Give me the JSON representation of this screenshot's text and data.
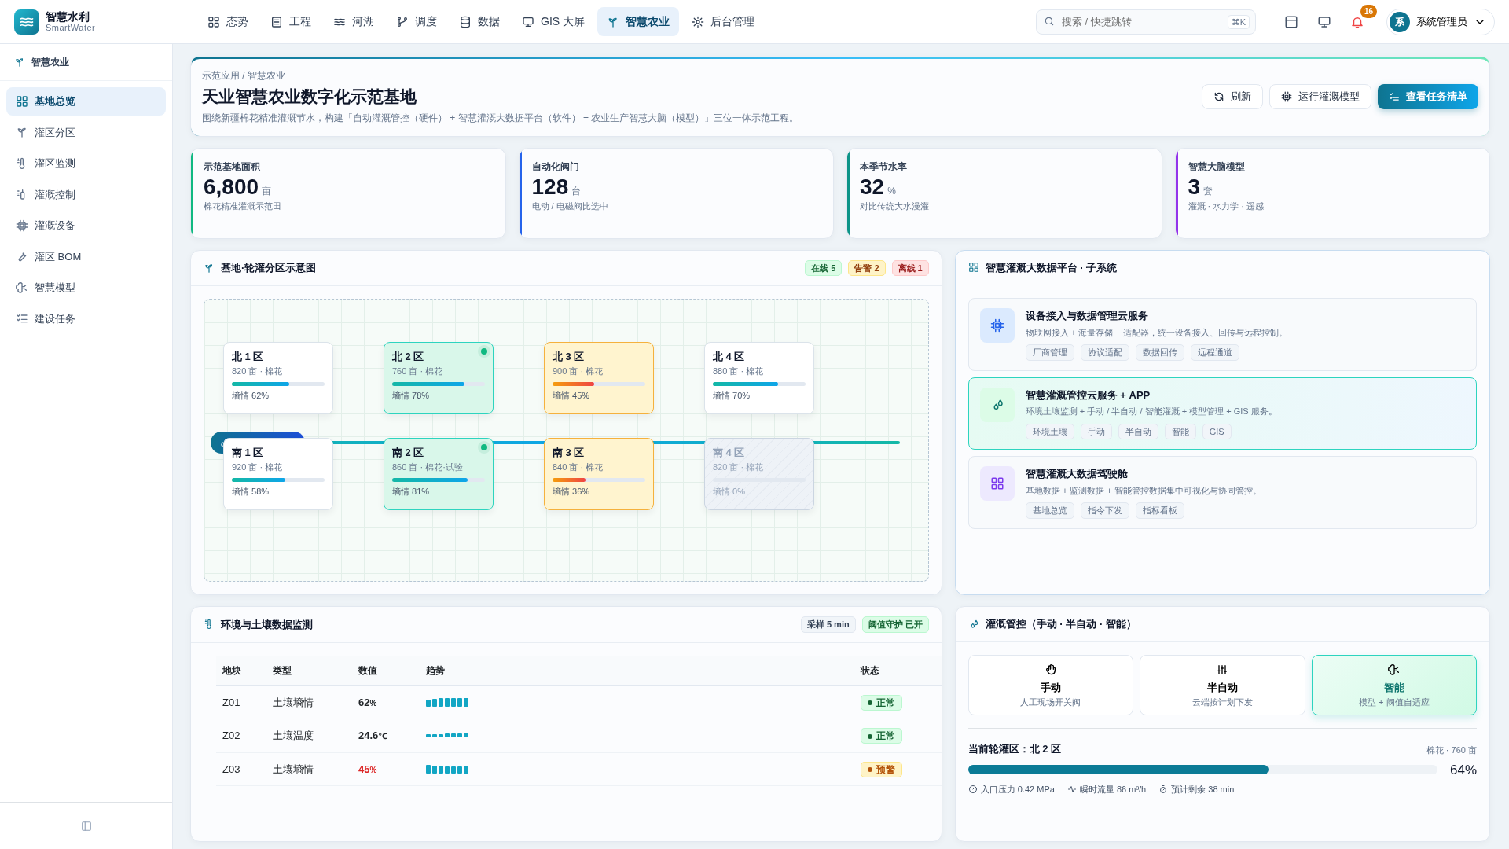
{
  "brand": {
    "name": "智慧水利",
    "sub": "SmartWater"
  },
  "nav": [
    {
      "label": "态势",
      "selected": false
    },
    {
      "label": "工程",
      "selected": false
    },
    {
      "label": "河湖",
      "selected": false
    },
    {
      "label": "调度",
      "selected": false
    },
    {
      "label": "数据",
      "selected": false
    },
    {
      "label": "GIS 大屏",
      "selected": false
    },
    {
      "label": "智慧农业",
      "selected": true
    },
    {
      "label": "后台管理",
      "selected": false
    }
  ],
  "search": {
    "placeholder": "搜索 / 快捷跳转",
    "shortcut": "⌘K"
  },
  "notifications": {
    "count": "16"
  },
  "user": {
    "avatar": "系",
    "name": "系统管理员"
  },
  "sidebar": {
    "title": "智慧农业",
    "items": [
      {
        "label": "基地总览",
        "selected": true
      },
      {
        "label": "灌区分区",
        "selected": false
      },
      {
        "label": "灌区监测",
        "selected": false
      },
      {
        "label": "灌溉控制",
        "selected": false
      },
      {
        "label": "灌溉设备",
        "selected": false
      },
      {
        "label": "灌区 BOM",
        "selected": false
      },
      {
        "label": "智慧模型",
        "selected": false
      },
      {
        "label": "建设任务",
        "selected": false
      }
    ]
  },
  "header": {
    "breadcrumb": "示范应用 / 智慧农业",
    "title": "天业智慧农业数字化示范基地",
    "description": "围绕新疆棉花精准灌溉节水，构建「自动灌溉管控（硬件） + 智慧灌溉大数据平台（软件） + 农业生产智慧大脑（模型）」三位一体示范工程。",
    "buttons": [
      {
        "label": "刷新",
        "kind": "outline"
      },
      {
        "label": "运行灌溉模型",
        "kind": "outline"
      },
      {
        "label": "查看任务清单",
        "kind": "primary"
      }
    ]
  },
  "kpis": [
    {
      "label": "示范基地面积",
      "value": "6,800",
      "unit": "亩",
      "note": "棉花精准灌溉示范田",
      "color": "#10b981"
    },
    {
      "label": "自动化阀门",
      "value": "128",
      "unit": "台",
      "note": "电动 / 电磁阀比选中",
      "color": "#2563eb"
    },
    {
      "label": "本季节水率",
      "value": "32",
      "unit": "%",
      "note": "对比传统大水漫灌",
      "color": "#0d9488"
    },
    {
      "label": "智慧大脑模型",
      "value": "3",
      "unit": "套",
      "note": "灌溉 · 水力学 · 遥感",
      "color": "#9333ea"
    }
  ],
  "zone_map": {
    "title": "基地·轮灌分区示意图",
    "badges": [
      {
        "label": "在线 5",
        "kind": "ok"
      },
      {
        "label": "告警 2",
        "kind": "warn"
      },
      {
        "label": "离线 1",
        "kind": "off"
      }
    ],
    "zones": [
      {
        "name": "北 1 区",
        "info": "820 亩 · 棉花",
        "level": 0.62,
        "reading": "墒情 62%",
        "kind": "normal"
      },
      {
        "name": "北 2 区",
        "info": "760 亩 · 棉花",
        "level": 0.78,
        "reading": "墒情 78%",
        "kind": "active"
      },
      {
        "name": "北 3 区",
        "info": "900 亩 · 棉花",
        "level": 0.45,
        "reading": "墒情 45%",
        "kind": "warning"
      },
      {
        "name": "北 4 区",
        "info": "880 亩 · 棉花",
        "level": 0.7,
        "reading": "墒情 70%",
        "kind": "normal"
      },
      {
        "name": "南 1 区",
        "info": "920 亩 · 棉花",
        "level": 0.58,
        "reading": "墒情 58%",
        "kind": "normal"
      },
      {
        "name": "南 2 区",
        "info": "860 亩 · 棉花·试验",
        "level": 0.81,
        "reading": "墒情 81%",
        "kind": "active"
      },
      {
        "name": "南 3 区",
        "info": "840 亩 · 棉花",
        "level": 0.36,
        "reading": "墒情 36%",
        "kind": "warning"
      },
      {
        "name": "南 4 区",
        "info": "820 亩 · 棉花",
        "level": 0,
        "reading": "墒情 0%",
        "kind": "offline"
      }
    ]
  },
  "subsystems": {
    "title": "智慧灌溉大数据平台 · 子系统",
    "items": [
      {
        "title": "设备接入与数据管理云服务",
        "description": "物联网接入 + 海量存储 + 适配器，统一设备接入、回传与远程控制。",
        "selected": false,
        "tags": [
          "厂商管理",
          "协议适配",
          "数据回传",
          "远程通道"
        ]
      },
      {
        "title": "智慧灌溉管控云服务 + APP",
        "description": "环境土壤监测 + 手动 / 半自动 / 智能灌溉 + 模型管理 + GIS 服务。",
        "selected": true,
        "tags": [
          "环境土壤",
          "手动",
          "半自动",
          "智能",
          "GIS"
        ]
      },
      {
        "title": "智慧灌溉大数据驾驶舱",
        "description": "基地数据 + 监测数据 + 智能管控数据集中可视化与协同管控。",
        "selected": false,
        "tags": [
          "基地总览",
          "指令下发",
          "指标看板"
        ]
      }
    ]
  },
  "monitoring": {
    "title": "环境与土壤数据监测",
    "badges": [
      {
        "label": "采样 5 min",
        "kind": "neutral"
      },
      {
        "label": "阈值守护 已开",
        "kind": "ok"
      }
    ],
    "columns": [
      "地块",
      "类型",
      "数值",
      "趋势",
      "状态"
    ],
    "rows": [
      {
        "plot": "Z01",
        "type": "土壤墒情",
        "value": "62",
        "unit": "%",
        "status": "正常",
        "kind": "normal"
      },
      {
        "plot": "Z02",
        "type": "土壤温度",
        "value": "24.6",
        "unit": "℃",
        "status": "正常",
        "kind": "normal"
      },
      {
        "plot": "Z03",
        "type": "土壤墒情",
        "value": "45",
        "unit": "%",
        "status": "预警",
        "kind": "warning"
      }
    ]
  },
  "control": {
    "title": "灌溉管控（手动 · 半自动 · 智能）",
    "modes": [
      {
        "label": "手动",
        "sub": "人工现场开关阀",
        "selected": false
      },
      {
        "label": "半自动",
        "sub": "云端按计划下发",
        "selected": false
      },
      {
        "label": "智能",
        "sub": "模型 + 阈值自适应",
        "selected": true
      }
    ],
    "current": {
      "label": "当前轮灌区：北 2 区",
      "note": "棉花 · 760 亩",
      "level": 0.64,
      "reading": "64%"
    },
    "stats": [
      "入口压力 0.42 MPa",
      "瞬时流量 86 m³/h",
      "预计剩余 38 min"
    ]
  }
}
